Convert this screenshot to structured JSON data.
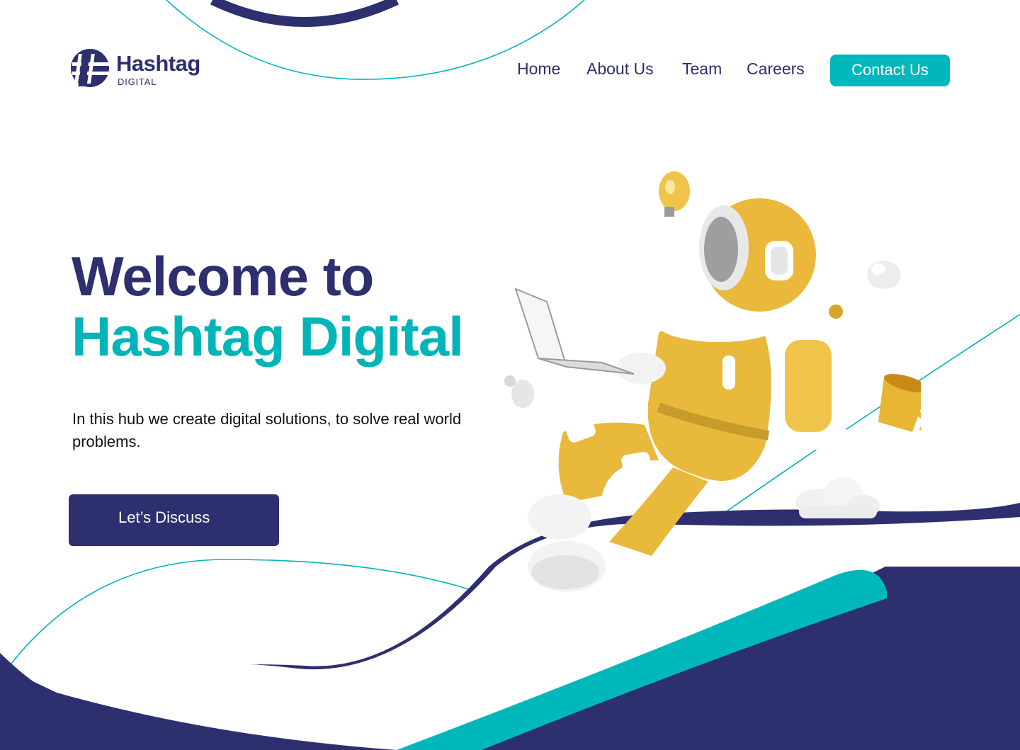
{
  "brand": {
    "name": "Hashtag",
    "sub": "DIGITAL"
  },
  "nav": {
    "items": [
      {
        "label": "Home"
      },
      {
        "label": "About Us"
      },
      {
        "label": "Team"
      },
      {
        "label": "Careers"
      }
    ],
    "contact_label": "Contact Us"
  },
  "hero": {
    "line1": "Welcome to",
    "line2": "Hashtag Digital",
    "description": "In this hub we create digital solutions, to solve real world problems.",
    "cta_label": "Let’s Discuss"
  },
  "colors": {
    "navy": "#2e2f6e",
    "teal": "#00b8bc",
    "gold": "#e8b634"
  },
  "icons": {
    "logo": "hashtag-logo-icon",
    "illustration": "astronaut-with-laptop-icon"
  }
}
